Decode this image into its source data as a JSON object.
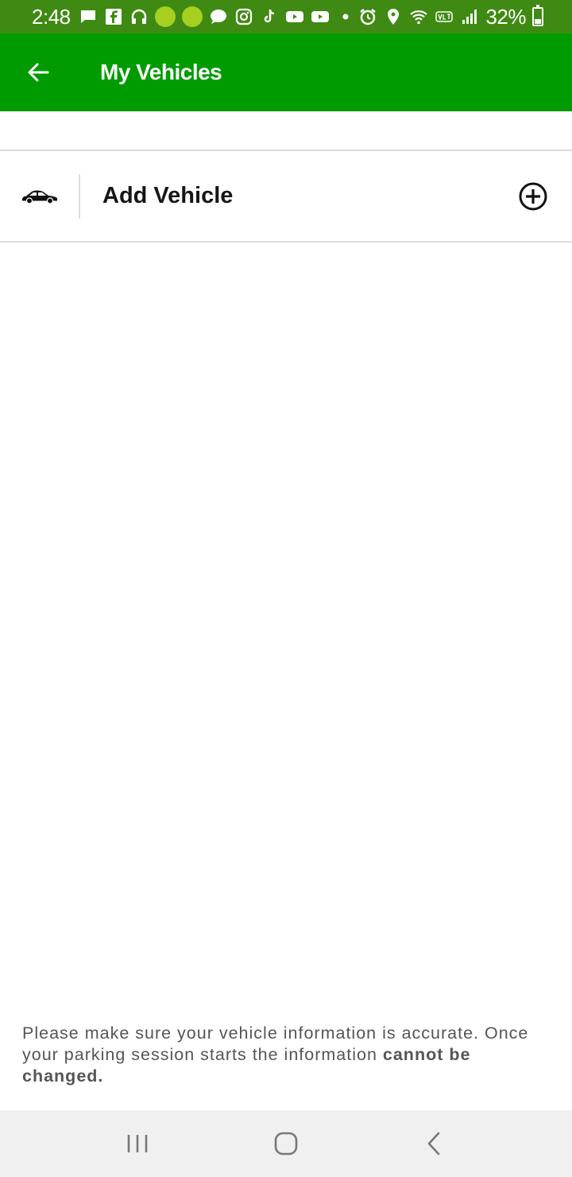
{
  "status_bar": {
    "time": "2:48",
    "battery": "32%",
    "battery_level": 0.32,
    "icons": [
      "message-icon",
      "facebook-icon",
      "headphones-icon",
      "app-pill-icon",
      "app-pill-icon",
      "chat-bubble-icon",
      "instagram-icon",
      "tiktok-icon",
      "youtube-icon",
      "youtube-icon",
      "dot-icon",
      "alarm-icon",
      "location-icon",
      "wifi-icon",
      "volte-icon",
      "signal-icon",
      "battery-icon"
    ]
  },
  "app_bar": {
    "title": "My Vehicles",
    "color": "#009b00"
  },
  "vehicles": {
    "add_label": "Add Vehicle"
  },
  "disclaimer": {
    "text": "Please make sure your vehicle information is accurate. Once your parking session starts the information ",
    "emphasis": "cannot be changed."
  },
  "nav_bar": {
    "buttons": [
      "recent-apps",
      "home",
      "back"
    ]
  }
}
